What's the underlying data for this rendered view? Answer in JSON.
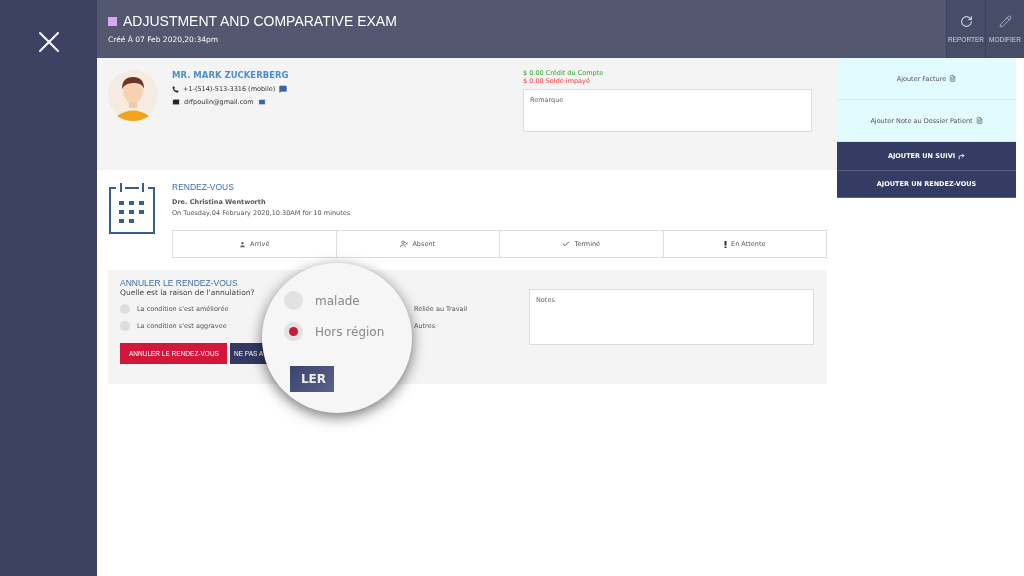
{
  "header": {
    "title": "ADJUSTMENT AND COMPARATIVE EXAM",
    "subtitle": "Créé À 07 Feb 2020,20:34pm",
    "actions": [
      {
        "label": "REPORTER",
        "kind": "reschedule"
      },
      {
        "label": "MODIFIER",
        "kind": "edit"
      }
    ]
  },
  "patient": {
    "name": "MR. MARK ZUCKERBERG",
    "phone": "+1-(514)-513-3316 (mobile)",
    "email": "drfpoulin@gmail.com"
  },
  "balance": {
    "credit": "$ 0.00 Crédit du Compte",
    "unpaid": "$ 0.00 Solde impayé"
  },
  "remark": {
    "placeholder": "Remarque"
  },
  "side_actions": [
    {
      "label": "Ajouter Facture",
      "kind": "light"
    },
    {
      "label": "Ajouter Note au Dossier Patient",
      "kind": "light"
    },
    {
      "label": "AJOUTER UN SUIVI",
      "kind": "dark-icon"
    },
    {
      "label": "AJOUTER UN RENDEZ-VOUS",
      "kind": "dark"
    }
  ],
  "appointment": {
    "heading": "RENDEZ-VOUS",
    "doctor": "Dre. Christina Wentworth",
    "when": "On Tuesday,04 February 2020,10:30AM for 10 minutes",
    "statuses": [
      {
        "label": "Arrivé",
        "kind": "user"
      },
      {
        "label": "Absent",
        "kind": "user-x"
      },
      {
        "label": "Terminé",
        "kind": "check"
      },
      {
        "label": "En Attente",
        "kind": "alert"
      }
    ]
  },
  "cancel": {
    "heading": "ANNULER LE RENDEZ-VOUS",
    "question": "Quelle est la raison de l'annulation?",
    "reasons": [
      {
        "label": "La condition s'est améliorée",
        "kind": "radio",
        "selected": false
      },
      {
        "label": "Reliée au Travail",
        "kind": "text"
      },
      {
        "label": "La condition s'est aggravee",
        "kind": "radio",
        "selected": false
      },
      {
        "label": "Autres",
        "kind": "text"
      }
    ],
    "notes": {
      "placeholder": "Notes"
    },
    "buttons": [
      {
        "label": "ANNULER LE RENDEZ-VOUS",
        "kind": "danger"
      },
      {
        "label": "NE PAS A",
        "kind": "dark"
      }
    ]
  },
  "magnifier": {
    "options": [
      {
        "label": "malade",
        "selected": false
      },
      {
        "label": "Hors région",
        "selected": true
      }
    ],
    "button_fragment": "LER"
  }
}
